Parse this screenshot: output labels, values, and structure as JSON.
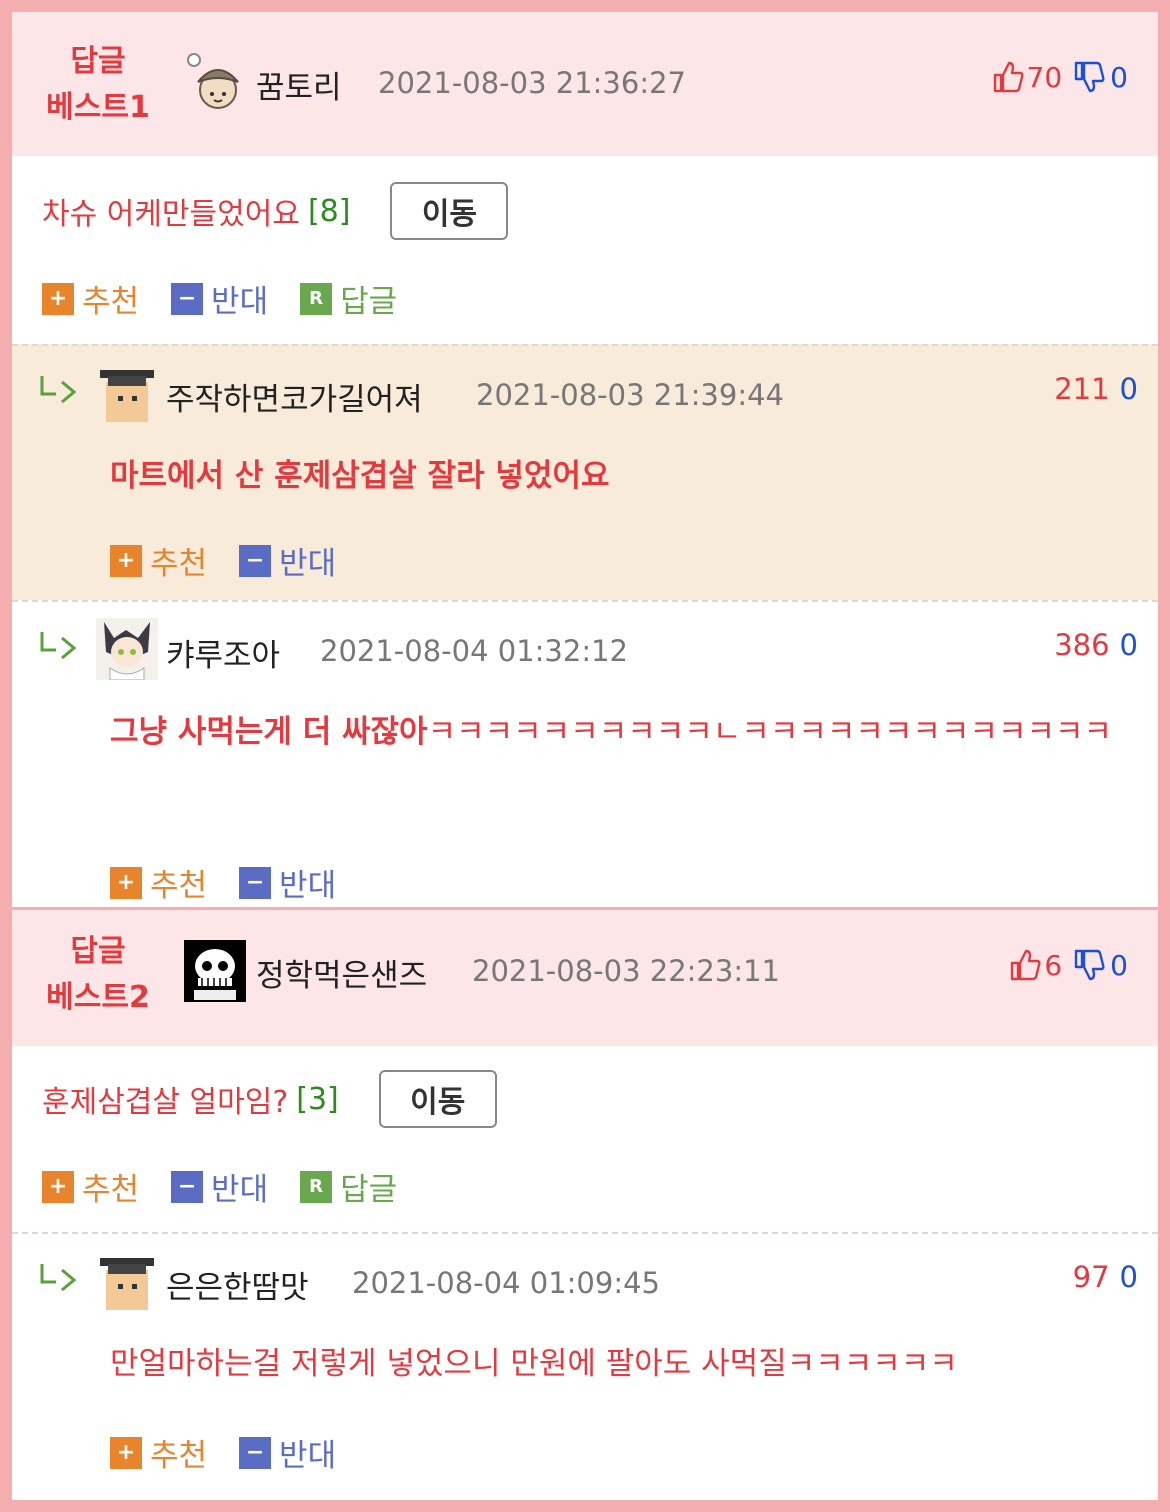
{
  "best1": {
    "label_line1": "답글",
    "label_line2": "베스트1",
    "nickname": "꿈토리",
    "datetime": "2021-08-03 21:36:27",
    "up": "70",
    "down": "0",
    "title": "차슈 어케만들었어요",
    "reply_count": "[8]",
    "move_label": "이동"
  },
  "best1_replies": [
    {
      "nickname": "주작하면코가길어져",
      "datetime": "2021-08-03 21:39:44",
      "up": "211",
      "down": "0",
      "text": "마트에서 산 훈제삼겹살 잘라 넣었어요"
    },
    {
      "nickname": "캬루조아",
      "datetime": "2021-08-04 01:32:12",
      "up": "386",
      "down": "0",
      "text_bold": "그냥 사먹는게 더 싸잖아",
      "text_rest": "ㅋㅋㅋㅋㅋㅋㅋㅋㅋㅋㄴㅋㅋㅋㅋㅋㅋㅋㅋㅋㅋㅋㅋㅋ"
    }
  ],
  "best2": {
    "label_line1": "답글",
    "label_line2": "베스트2",
    "nickname": "정학먹은샌즈",
    "datetime": "2021-08-03 22:23:11",
    "up": "6",
    "down": "0",
    "title": "훈제삼겹살 얼마임?",
    "reply_count": "[3]",
    "move_label": "이동"
  },
  "best2_replies": [
    {
      "nickname": "은은한땀맛",
      "datetime": "2021-08-04 01:09:45",
      "up": "97",
      "down": "0",
      "text": "만얼마하는걸 저렇게 넣었으니 만원에 팔아도 사먹질ㅋㅋㅋㅋㅋㅋ"
    }
  ],
  "actions": {
    "recommend": "추천",
    "oppose": "반대",
    "reply": "답글",
    "plus_glyph": "+",
    "minus_glyph": "−",
    "reply_glyph": "R"
  },
  "colors": {
    "accent_red": "#e23a3f",
    "down_blue": "#1a4fd6",
    "recommend_orange": "#e8842b",
    "oppose_blue": "#5a6cc4",
    "reply_green": "#6aa84f",
    "frame_pink": "#f5aeb0",
    "header_pink": "#fce6e8",
    "highlight_beige": "#f8ebd9"
  }
}
